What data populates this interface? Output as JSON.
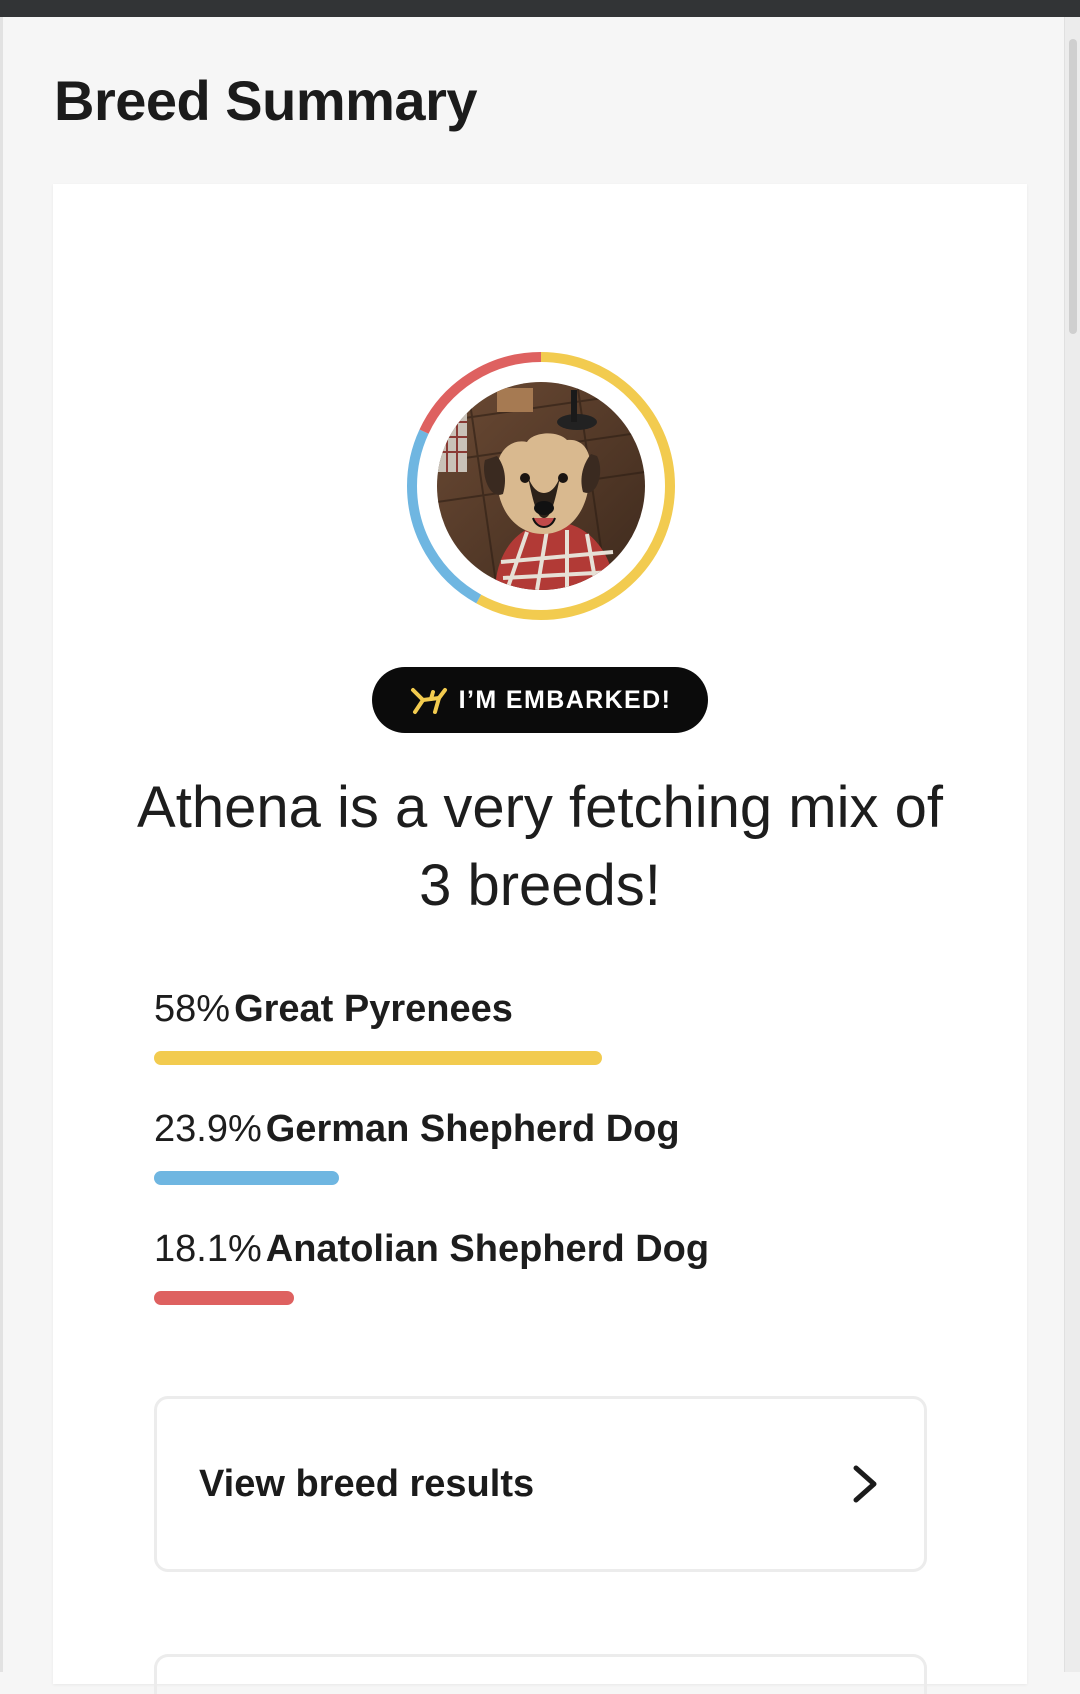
{
  "page": {
    "title": "Breed Summary"
  },
  "summary": {
    "badge_text": "I’M EMBARKED!",
    "headline": "Athena is a very fetching mix of 3 breeds!"
  },
  "breeds": [
    {
      "percent_label": "58%",
      "percent": 58,
      "name": "Great Pyrenees",
      "color": "#f2cb4f"
    },
    {
      "percent_label": "23.9%",
      "percent": 23.9,
      "name": "German Shepherd Dog",
      "color": "#6fb6e1"
    },
    {
      "percent_label": "18.1%",
      "percent": 18.1,
      "name": "Anatolian Shepherd Dog",
      "color": "#de6160"
    }
  ],
  "actions": {
    "view_results_label": "View breed results"
  },
  "colors": {
    "badge_bg": "#0b0b0b",
    "badge_icon": "#f2cb4f",
    "card_bg": "#ffffff",
    "page_bg": "#f6f6f6"
  },
  "icons": {
    "badge": "embark-logo-icon",
    "button": "chevron-right-icon"
  }
}
